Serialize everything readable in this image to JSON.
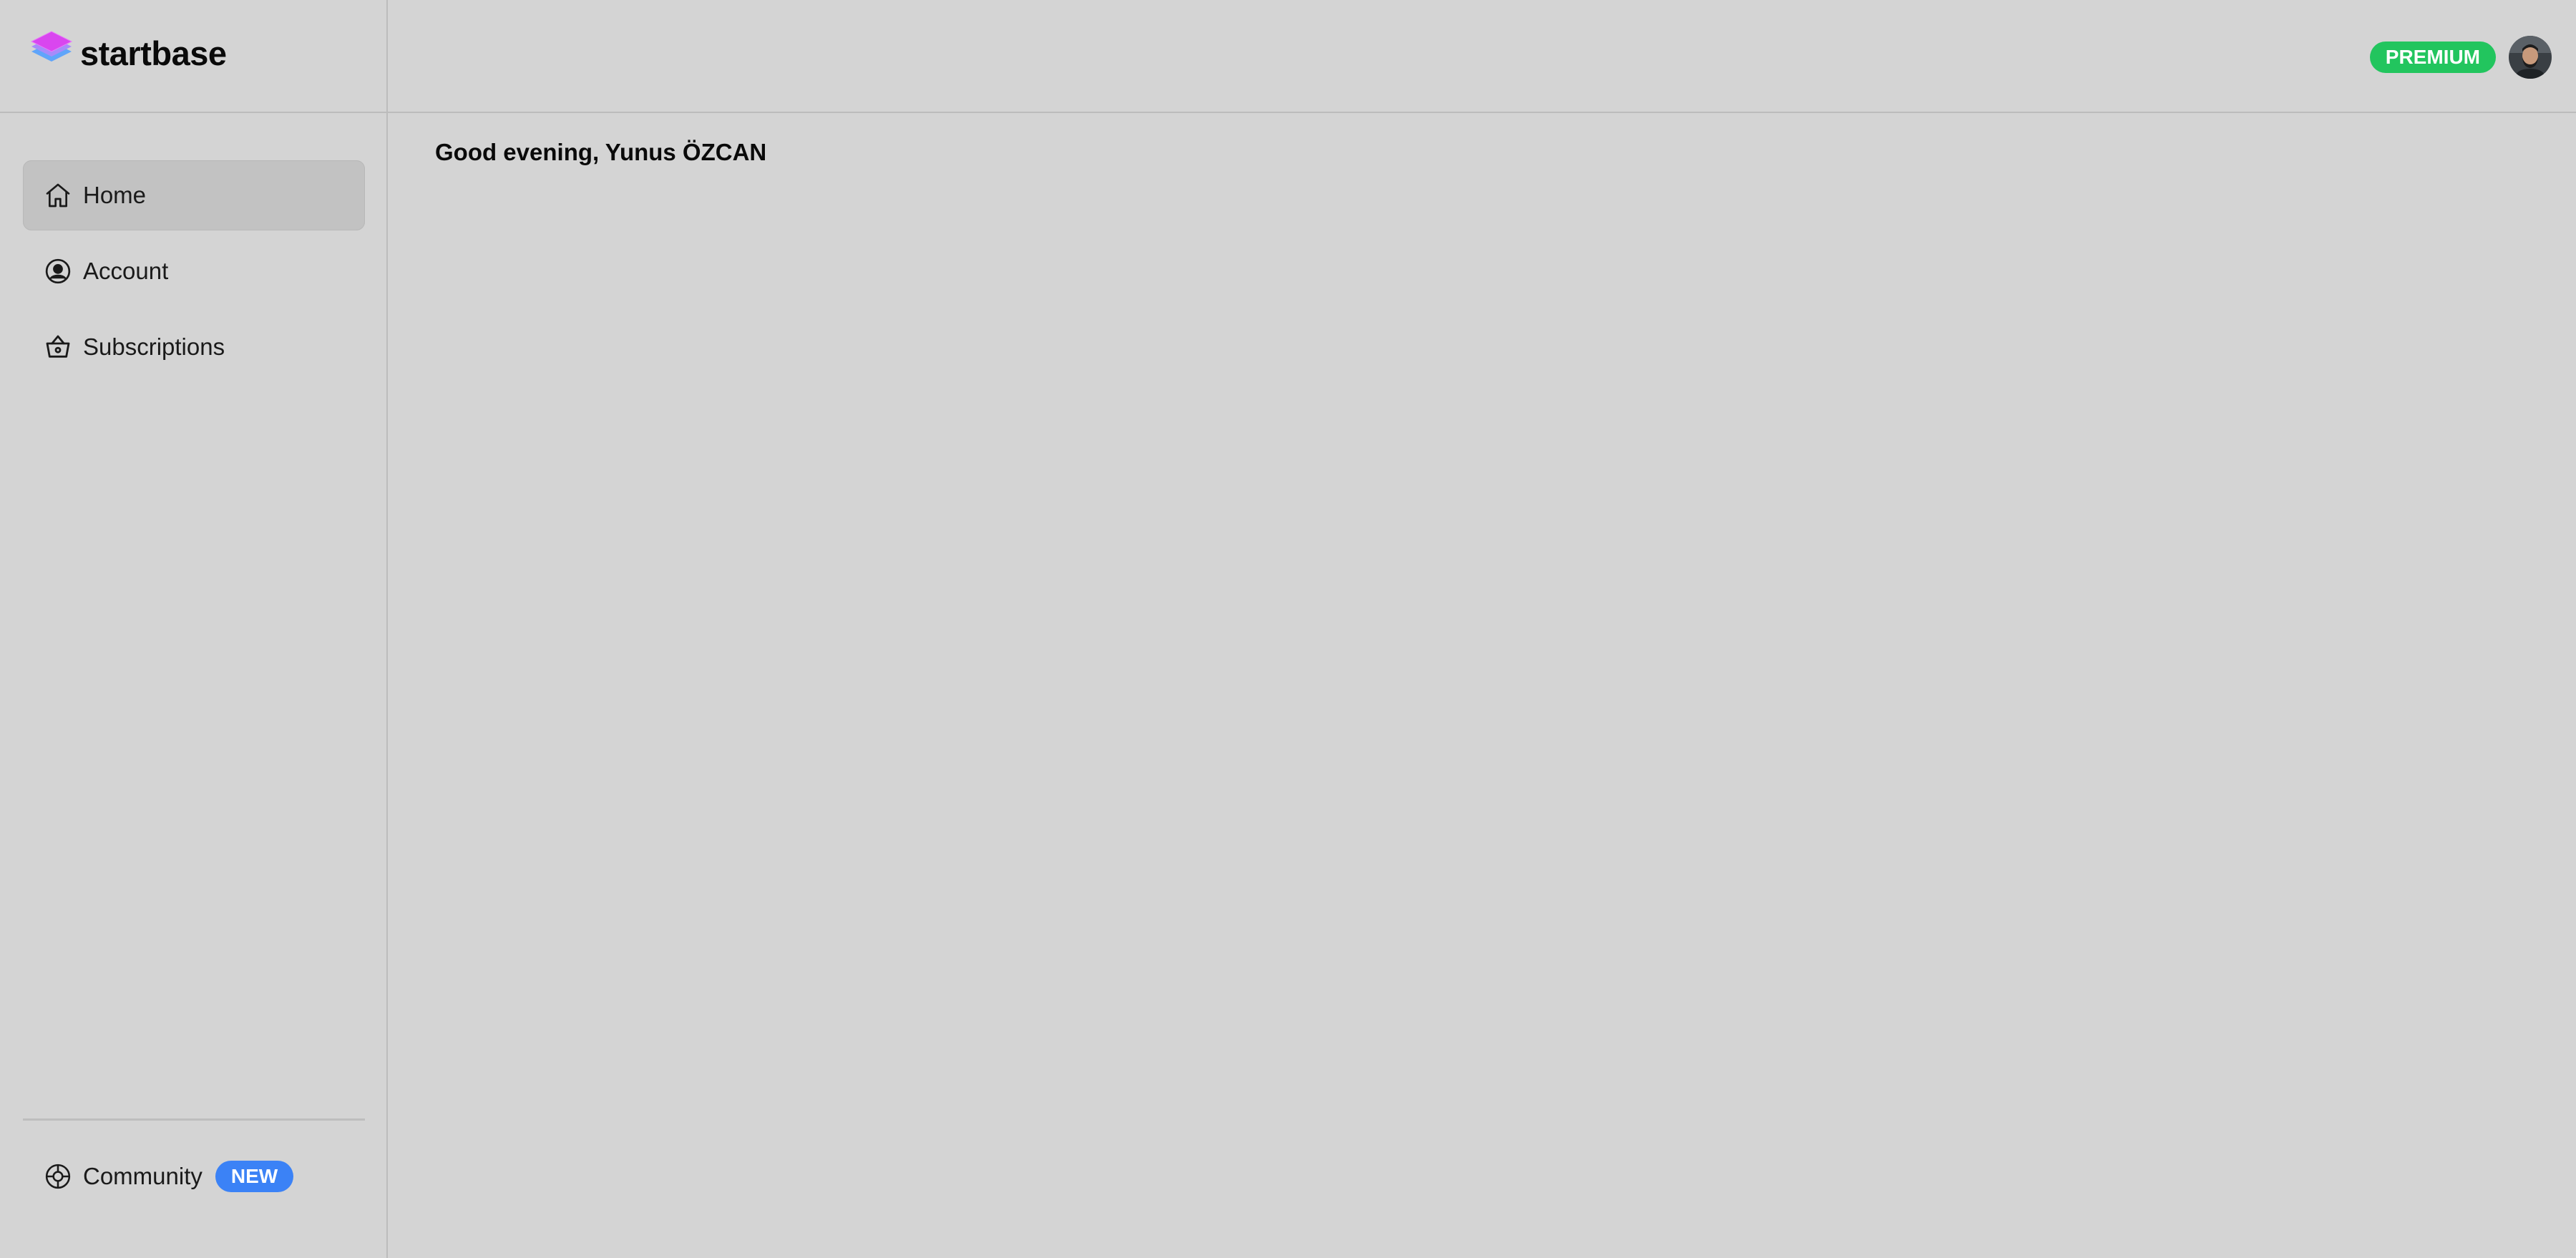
{
  "brand": {
    "name": "startbase",
    "logo_icon": "layers-icon"
  },
  "sidebar": {
    "items": [
      {
        "label": "Home",
        "icon": "home-icon",
        "active": true
      },
      {
        "label": "Account",
        "icon": "user-circle-icon",
        "active": false
      },
      {
        "label": "Subscriptions",
        "icon": "basket-icon",
        "active": false
      }
    ],
    "community": {
      "label": "Community",
      "icon": "globe-icon",
      "badge": "NEW"
    }
  },
  "topbar": {
    "plan_badge": "PREMIUM",
    "avatar_icon": "user-avatar"
  },
  "main": {
    "greeting": "Good evening, Yunus ÖZCAN"
  },
  "colors": {
    "background": "#d4d4d4",
    "active_item": "#c2c2c2",
    "premium_badge": "#22c55e",
    "new_badge": "#3b82f6",
    "logo_top": "#d946ef",
    "logo_bottom": "#60a5fa"
  }
}
